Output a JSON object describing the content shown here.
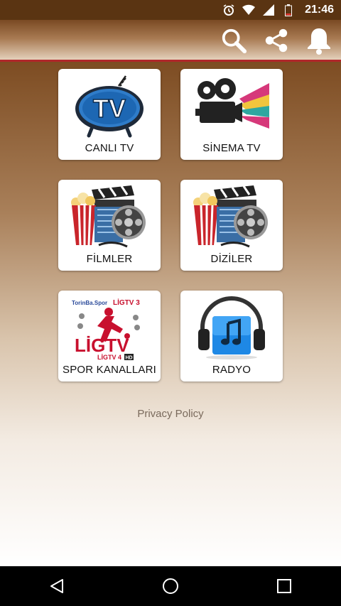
{
  "status_bar": {
    "time": "21:46",
    "icons": [
      "alarm-icon",
      "wifi-icon",
      "signal-icon",
      "battery-icon"
    ]
  },
  "app_bar": {
    "actions": [
      "search-icon",
      "share-icon",
      "bell-icon"
    ]
  },
  "tiles": [
    {
      "label": "CANLI TV",
      "icon": "tv-icon"
    },
    {
      "label": "SİNEMA TV",
      "icon": "movie-camera-icon"
    },
    {
      "label": "FİLMLER",
      "icon": "popcorn-film-icon"
    },
    {
      "label": "DİZİLER",
      "icon": "popcorn-film-icon"
    },
    {
      "label": "SPOR KANALLARI",
      "icon": "lig-tv-logo"
    },
    {
      "label": "RADYO",
      "icon": "headphones-music-icon"
    }
  ],
  "tile_logo_text": {
    "lig_brand": "LİGTV",
    "lig_tv3": "LİGTV 3",
    "lig_tv4": "LİGTV 4",
    "hd": "HD",
    "spor_channel": "TorinBa.Spor"
  },
  "privacy_policy": "Privacy Policy",
  "nav": [
    "back-icon",
    "home-icon",
    "recents-icon"
  ]
}
